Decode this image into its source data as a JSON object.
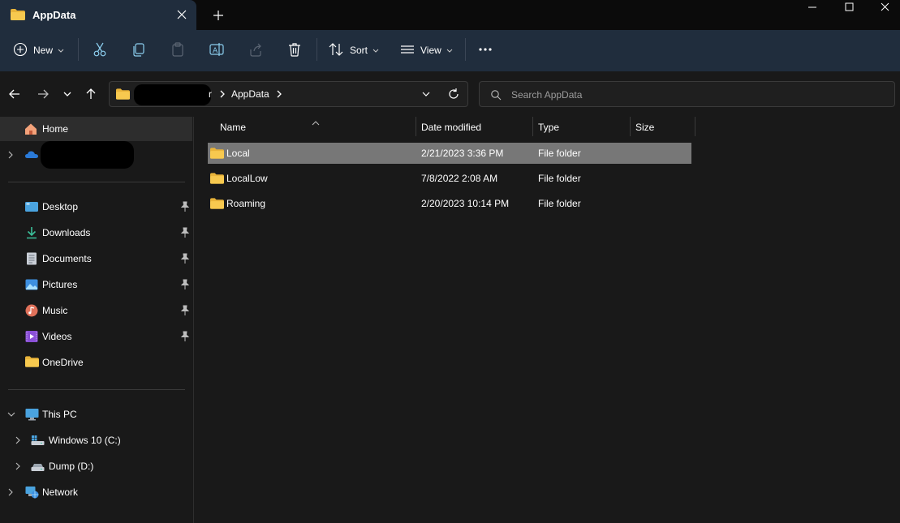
{
  "window": {
    "tab_title": "AppData"
  },
  "toolbar": {
    "new_label": "New",
    "sort_label": "Sort",
    "view_label": "View"
  },
  "address": {
    "path_current": "AppData",
    "path_partial": "r"
  },
  "search": {
    "placeholder": "Search AppData"
  },
  "sidebar": {
    "home": "Home",
    "quick_access": [
      {
        "label": "Desktop",
        "icon": "desktop-icon"
      },
      {
        "label": "Downloads",
        "icon": "downloads-icon"
      },
      {
        "label": "Documents",
        "icon": "documents-icon"
      },
      {
        "label": "Pictures",
        "icon": "pictures-icon"
      },
      {
        "label": "Music",
        "icon": "music-icon"
      },
      {
        "label": "Videos",
        "icon": "videos-icon"
      },
      {
        "label": "OneDrive",
        "icon": "folder-icon"
      }
    ],
    "this_pc": "This PC",
    "drives": [
      {
        "label": "Windows 10 (C:)"
      },
      {
        "label": "Dump (D:)"
      }
    ],
    "network": "Network"
  },
  "columns": {
    "name": "Name",
    "date": "Date modified",
    "type": "Type",
    "size": "Size"
  },
  "files": [
    {
      "name": "Local",
      "date": "2/21/2023 3:36 PM",
      "type": "File folder"
    },
    {
      "name": "LocalLow",
      "date": "7/8/2022 2:08 AM",
      "type": "File folder"
    },
    {
      "name": "Roaming",
      "date": "2/20/2023 10:14 PM",
      "type": "File folder"
    }
  ],
  "colors": {
    "accent_bar": "#202d3d",
    "background": "#191919",
    "selection": "#777777",
    "folder": "#f7c94f"
  }
}
